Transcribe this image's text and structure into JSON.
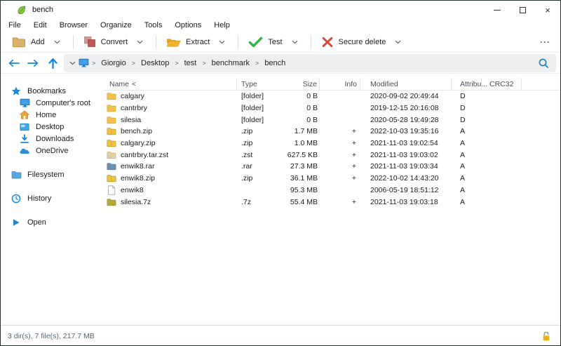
{
  "window": {
    "title": "bench",
    "controls": [
      {
        "name": "minimize"
      },
      {
        "name": "maximize"
      },
      {
        "name": "close",
        "glyph": "×"
      }
    ]
  },
  "menu": {
    "items": [
      "File",
      "Edit",
      "Browser",
      "Organize",
      "Tools",
      "Options",
      "Help"
    ]
  },
  "toolbar": {
    "buttons": [
      {
        "label": "Add",
        "icon": "add-folder-icon"
      },
      {
        "label": "Convert",
        "icon": "convert-icon"
      },
      {
        "label": "Extract",
        "icon": "extract-icon"
      },
      {
        "label": "Test",
        "icon": "test-icon"
      },
      {
        "label": "Secure delete",
        "icon": "secure-delete-icon"
      }
    ],
    "more_label": "···"
  },
  "addressbar": {
    "separator": ">",
    "root_icon": "computer-icon",
    "path": [
      "Giorgio",
      "Desktop",
      "test",
      "benchmark",
      "bench"
    ]
  },
  "sidebar": {
    "sections": [
      {
        "label": "Bookmarks",
        "icon": "star-icon",
        "children": [
          {
            "label": "Computer's root",
            "icon": "computer-icon"
          },
          {
            "label": "Home",
            "icon": "home-icon"
          },
          {
            "label": "Desktop",
            "icon": "desktop-icon"
          },
          {
            "label": "Downloads",
            "icon": "downloads-icon"
          },
          {
            "label": "OneDrive",
            "icon": "cloud-icon"
          }
        ]
      },
      {
        "label": "Filesystem",
        "icon": "folder-blue-icon",
        "children": []
      },
      {
        "label": "History",
        "icon": "history-icon",
        "children": []
      },
      {
        "label": "Open",
        "icon": "open-icon",
        "children": []
      }
    ]
  },
  "filelist": {
    "sort_indicator": "<",
    "headers": [
      {
        "label": "Name"
      },
      {
        "label": "Type"
      },
      {
        "label": "Size"
      },
      {
        "label": "Info"
      },
      {
        "label": "Modified"
      },
      {
        "label": "Attribu..."
      },
      {
        "label": "CRC32"
      }
    ],
    "rows": [
      {
        "name": "calgary",
        "icon": "folder",
        "type": "[folder]",
        "size": "0 B",
        "info": "",
        "modified": "2020-09-02 20:49:44",
        "attrib": "D",
        "crc32": ""
      },
      {
        "name": "cantrbry",
        "icon": "folder",
        "type": "[folder]",
        "size": "0 B",
        "info": "",
        "modified": "2019-12-15 20:16:08",
        "attrib": "D",
        "crc32": ""
      },
      {
        "name": "silesia",
        "icon": "folder",
        "type": "[folder]",
        "size": "0 B",
        "info": "",
        "modified": "2020-05-28 19:49:28",
        "attrib": "D",
        "crc32": ""
      },
      {
        "name": "bench.zip",
        "icon": "zip",
        "type": ".zip",
        "size": "1.7 MB",
        "info": "+",
        "modified": "2022-10-03 19:35:16",
        "attrib": "A",
        "crc32": ""
      },
      {
        "name": "calgary.zip",
        "icon": "zip",
        "type": ".zip",
        "size": "1.0 MB",
        "info": "+",
        "modified": "2021-11-03 19:02:54",
        "attrib": "A",
        "crc32": ""
      },
      {
        "name": "cantrbry.tar.zst",
        "icon": "zst",
        "type": ".zst",
        "size": "627.5 KB",
        "info": "+",
        "modified": "2021-11-03 19:03:02",
        "attrib": "A",
        "crc32": ""
      },
      {
        "name": "enwik8.rar",
        "icon": "rar",
        "type": ".rar",
        "size": "27.3 MB",
        "info": "+",
        "modified": "2021-11-03 19:03:34",
        "attrib": "A",
        "crc32": ""
      },
      {
        "name": "enwik8.zip",
        "icon": "zip",
        "type": ".zip",
        "size": "36.1 MB",
        "info": "+",
        "modified": "2022-10-02 14:43:20",
        "attrib": "A",
        "crc32": ""
      },
      {
        "name": "enwik8",
        "icon": "file",
        "type": "",
        "size": "95.3 MB",
        "info": "",
        "modified": "2006-05-19 18:51:12",
        "attrib": "A",
        "crc32": ""
      },
      {
        "name": "silesia.7z",
        "icon": "7z",
        "type": ".7z",
        "size": "55.4 MB",
        "info": "+",
        "modified": "2021-11-03 19:03:18",
        "attrib": "A",
        "crc32": ""
      }
    ]
  },
  "statusbar": {
    "text": "3 dir(s), 7 file(s), 217.7 MB",
    "lock_icon": "open-padlock-icon"
  },
  "colors": {
    "accent_blue": "#1f86d6",
    "leaf_green": "#8dc63f",
    "leaf_dark": "#4e9a2e",
    "folder_gold": "#f2c04d",
    "folder_gold_dark": "#d79c28",
    "zip_gold": "#eec33e",
    "zst_tan": "#e2cda4",
    "rar_blue": "#6b93b0",
    "sevenz_olive": "#aeab3e",
    "check_green": "#35b34a",
    "delete_red": "#d8473a",
    "convert_back": "#d39a98",
    "convert_front": "#bf5a57",
    "add_tan": "#dcb469",
    "extract_gold": "#f2b42a",
    "lock_gold": "#e9b41c",
    "home_orange": "#e8a33d"
  }
}
